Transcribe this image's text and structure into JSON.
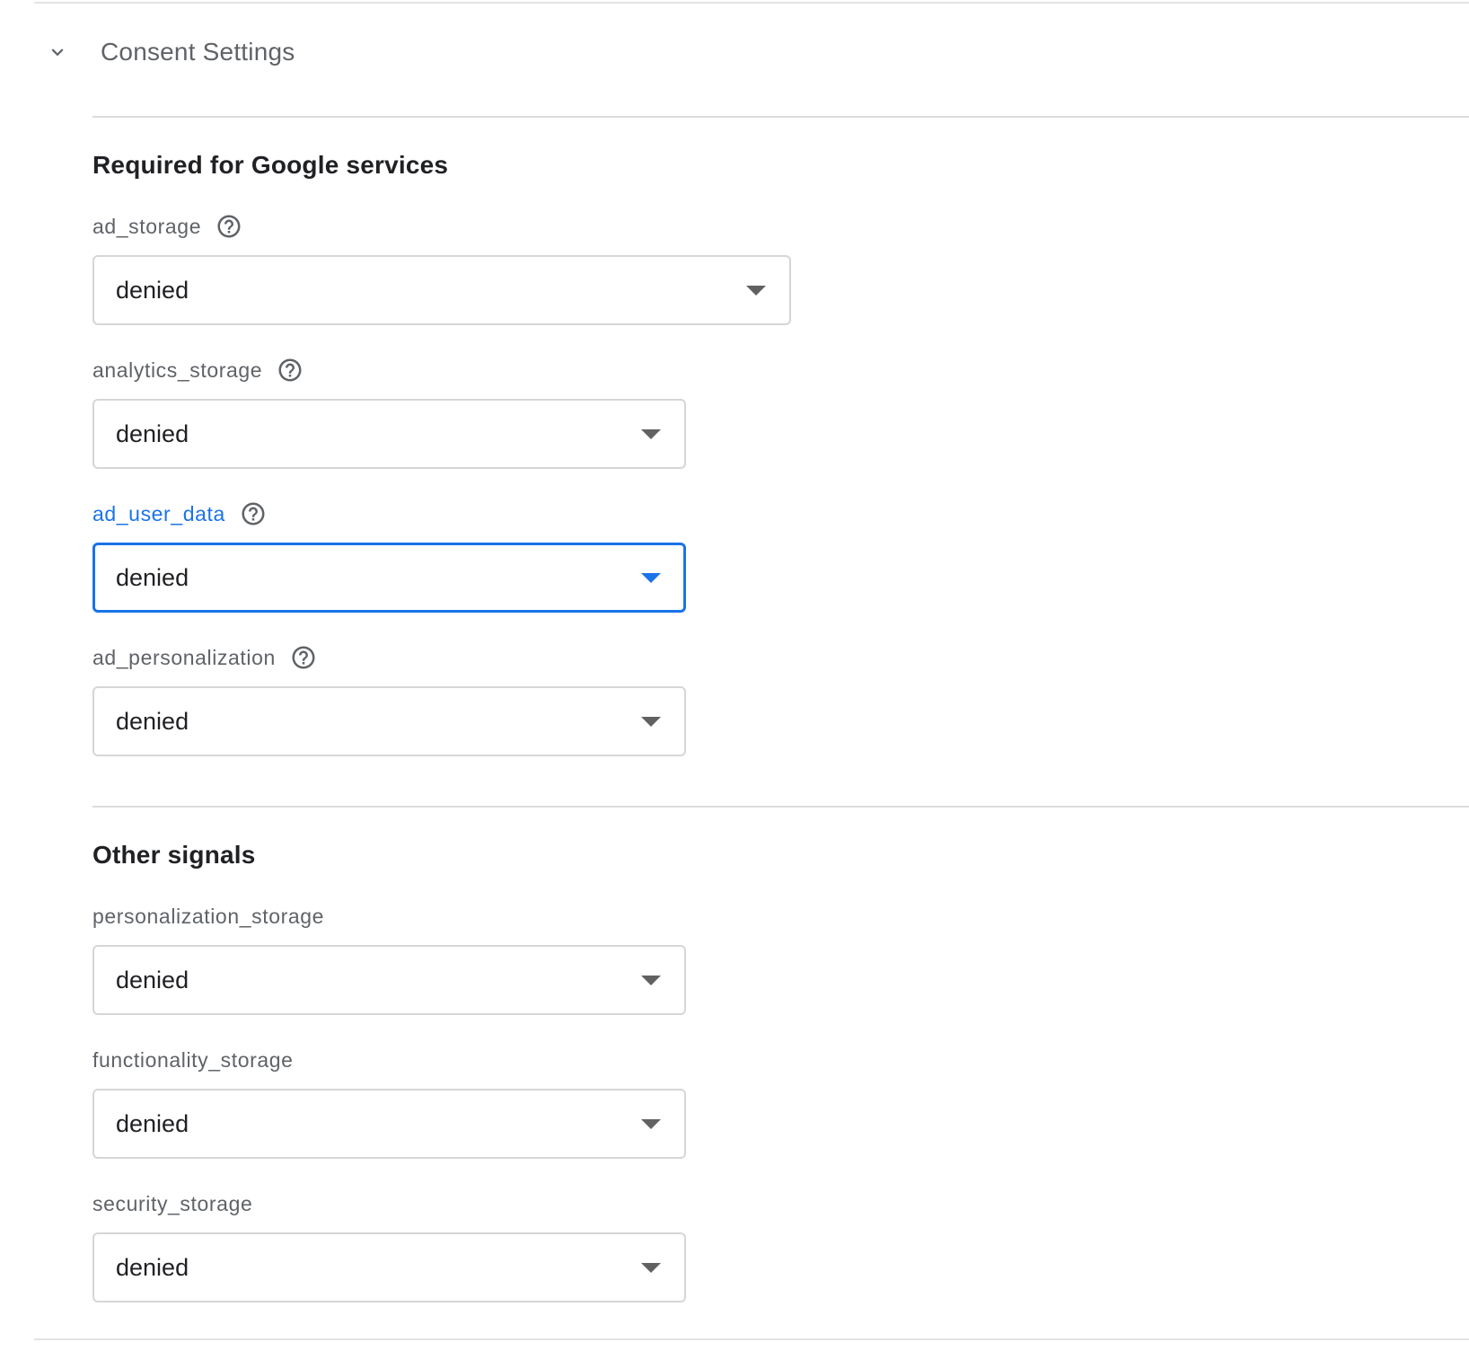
{
  "section": {
    "title": "Consent Settings",
    "expanded": true,
    "icon": "chevron-down-icon"
  },
  "groups": [
    {
      "title": "Required for Google services",
      "fields": [
        {
          "label": "ad_storage",
          "value": "denied",
          "help": true,
          "focused": false
        },
        {
          "label": "analytics_storage",
          "value": "denied",
          "help": true,
          "focused": false
        },
        {
          "label": "ad_user_data",
          "value": "denied",
          "help": true,
          "focused": true
        },
        {
          "label": "ad_personalization",
          "value": "denied",
          "help": true,
          "focused": false
        }
      ]
    },
    {
      "title": "Other signals",
      "fields": [
        {
          "label": "personalization_storage",
          "value": "denied",
          "help": false,
          "focused": false
        },
        {
          "label": "functionality_storage",
          "value": "denied",
          "help": false,
          "focused": false
        },
        {
          "label": "security_storage",
          "value": "denied",
          "help": false,
          "focused": false
        }
      ]
    }
  ],
  "colors": {
    "focus_accent": "#1a73e8",
    "label_text": "#5f6368",
    "value_text": "#202124",
    "border": "#d6d6d6",
    "arrow": "#616161"
  }
}
